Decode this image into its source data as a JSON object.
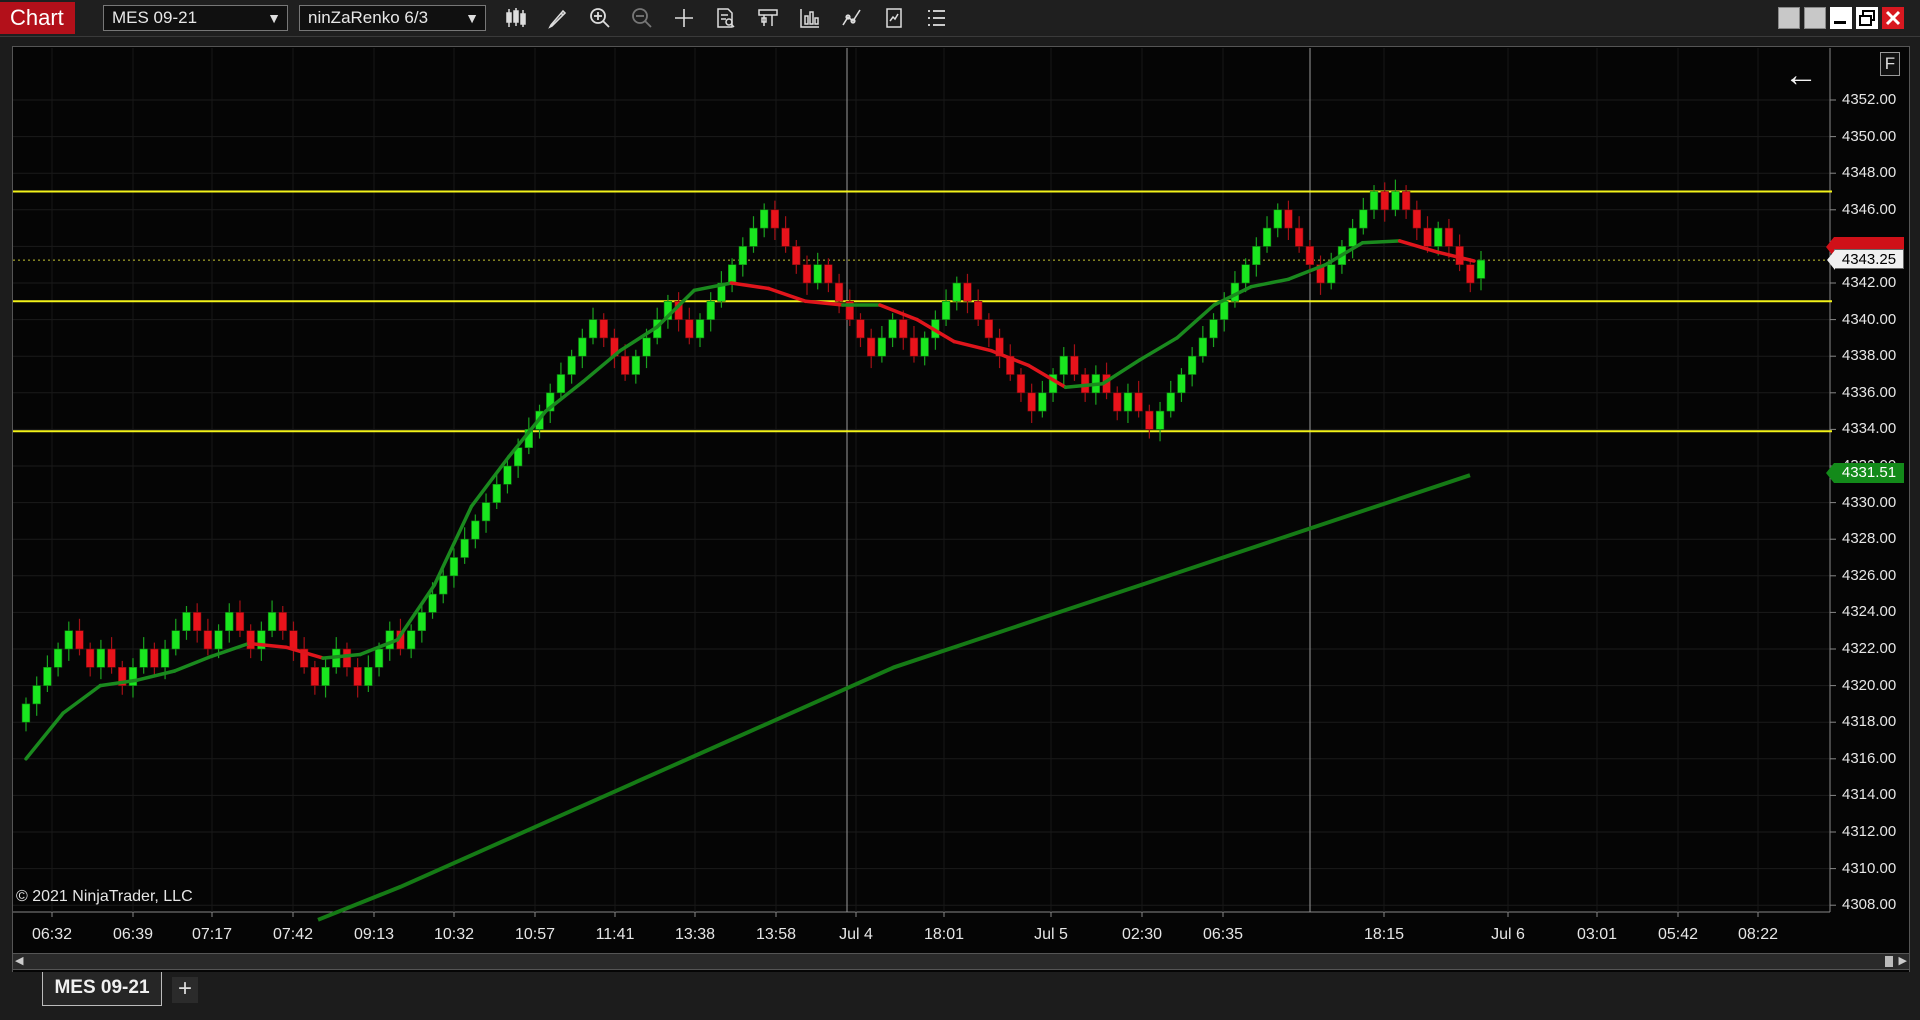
{
  "toolbar": {
    "title": "Chart",
    "instrument": "MES 09-21",
    "period": "ninZaRenko 6/3"
  },
  "chart": {
    "copyright": "© 2021 NinjaTrader, LLC",
    "f_button": "F",
    "current_price_label": "4343.25",
    "ma_slow_label": "4331.51"
  },
  "tabs": {
    "active": "MES 09-21",
    "add": "+"
  },
  "chart_data": {
    "type": "candlestick",
    "instrument": "MES 09-21",
    "bar_type": "ninZaRenko 6/3",
    "y_ticks": [
      4352,
      4350,
      4348,
      4346,
      4344,
      4342,
      4340,
      4338,
      4336,
      4334,
      4332,
      4330,
      4328,
      4326,
      4324,
      4322,
      4320,
      4318,
      4316,
      4314,
      4312,
      4310,
      4308
    ],
    "y_tick_labels": [
      "4352.00",
      "4350.00",
      "4348.00",
      "4346.00",
      "4344.00",
      "4342.00",
      "4340.00",
      "4338.00",
      "4336.00",
      "4334.00",
      "4332.00",
      "4330.00",
      "4328.00",
      "4326.00",
      "4324.00",
      "4322.00",
      "4320.00",
      "4318.00",
      "4316.00",
      "4314.00",
      "4312.00",
      "4310.00",
      "4308.00"
    ],
    "ylim": [
      4307.2,
      4353.5
    ],
    "x_ticks": [
      "06:32",
      "06:39",
      "07:17",
      "07:42",
      "09:13",
      "10:32",
      "10:57",
      "11:41",
      "13:38",
      "13:58",
      "Jul 4",
      "18:01",
      "Jul 5",
      "02:30",
      "06:35",
      "18:15",
      "Jul 6",
      "03:01",
      "05:42",
      "08:22"
    ],
    "horizontal_lines": [
      4347.0,
      4341.0,
      4333.9
    ],
    "current_price": 4343.25,
    "hidden_price_tag": 4343.0,
    "ma_slow_last": 4331.51,
    "closes": [
      4319,
      4320,
      4321,
      4322,
      4323,
      4322,
      4321,
      4322,
      4321,
      4320,
      4321,
      4322,
      4321,
      4322,
      4323,
      4324,
      4323,
      4322,
      4323,
      4324,
      4323,
      4322,
      4323,
      4324,
      4323,
      4322,
      4321,
      4320,
      4321,
      4322,
      4321,
      4320,
      4321,
      4322,
      4323,
      4322,
      4323,
      4324,
      4325,
      4326,
      4327,
      4328,
      4329,
      4330,
      4331,
      4332,
      4333,
      4334,
      4335,
      4336,
      4337,
      4338,
      4339,
      4340,
      4339,
      4338,
      4337,
      4338,
      4339,
      4340,
      4341,
      4340,
      4339,
      4340,
      4341,
      4342,
      4343,
      4344,
      4345,
      4346,
      4345,
      4344,
      4343,
      4342,
      4343,
      4342,
      4341,
      4340,
      4339,
      4338,
      4339,
      4340,
      4339,
      4338,
      4339,
      4340,
      4341,
      4342,
      4341,
      4340,
      4339,
      4338,
      4337,
      4336,
      4335,
      4336,
      4337,
      4338,
      4337,
      4336,
      4337,
      4336,
      4335,
      4336,
      4335,
      4334,
      4335,
      4336,
      4337,
      4338,
      4339,
      4340,
      4341,
      4342,
      4343,
      4344,
      4345,
      4346,
      4345,
      4344,
      4343,
      4342,
      4343,
      4344,
      4345,
      4346,
      4347,
      4346,
      4347,
      4346,
      4345,
      4344,
      4345,
      4344,
      4343,
      4342,
      4343.25
    ],
    "ma_fast": [
      4316,
      4318.5,
      4320,
      4320.3,
      4320.8,
      4321.6,
      4322.3,
      4322.1,
      4321.5,
      4321.7,
      4322.5,
      4325.5,
      4329.8,
      4332.5,
      4335,
      4336.6,
      4338.3,
      4339.6,
      4341.6,
      4342,
      4341.7,
      4341,
      4340.8,
      4340.8,
      4340,
      4338.8,
      4338.3,
      4337.5,
      4336.3,
      4336.5,
      4337.8,
      4339,
      4340.8,
      4341.8,
      4342.2,
      4343,
      4344.2,
      4344.3,
      4343.7,
      4343.2
    ],
    "ma_slow": [
      4307.2,
      4309,
      4311,
      4313,
      4315,
      4317,
      4319,
      4321,
      4322.5,
      4324,
      4325.5,
      4327,
      4328.5,
      4330,
      4331.5
    ]
  }
}
